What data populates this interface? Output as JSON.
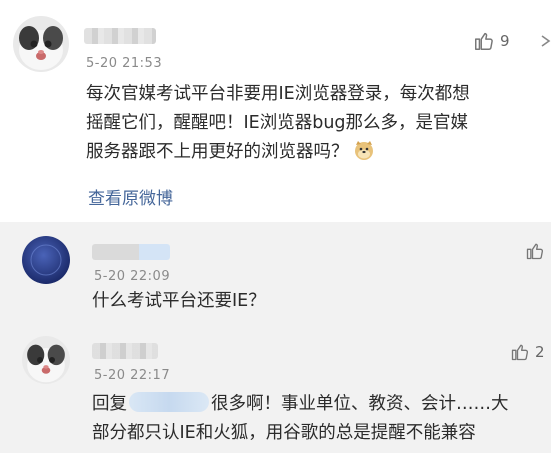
{
  "comment": {
    "time": "5-20 21:53",
    "likes": "9",
    "text_line1": "每次官媒考试平台非要用IE浏览器登录，每次都想",
    "text_line2": "摇醒它们，醒醒吧！IE浏览器bug那么多，是官媒",
    "text_line3": "服务器跟不上用更好的浏览器吗？",
    "emoji_icon": "doge-icon",
    "view_original": "查看原微博"
  },
  "replies": [
    {
      "time": "5-20 22:09",
      "likes": "",
      "text": "什么考试平台还要IE？"
    },
    {
      "time": "5-20 22:17",
      "likes": "2",
      "text_prefix": "回复",
      "text_line1_rest": "很多啊！事业单位、教资、会计……大",
      "text_line2": "部分都只认IE和火狐，用谷歌的总是提醒不能兼容"
    }
  ],
  "colors": {
    "link": "#46679a",
    "reply_bg": "#f2f2f2",
    "main_bg": "#ffffff",
    "time": "#8a8a8a"
  }
}
